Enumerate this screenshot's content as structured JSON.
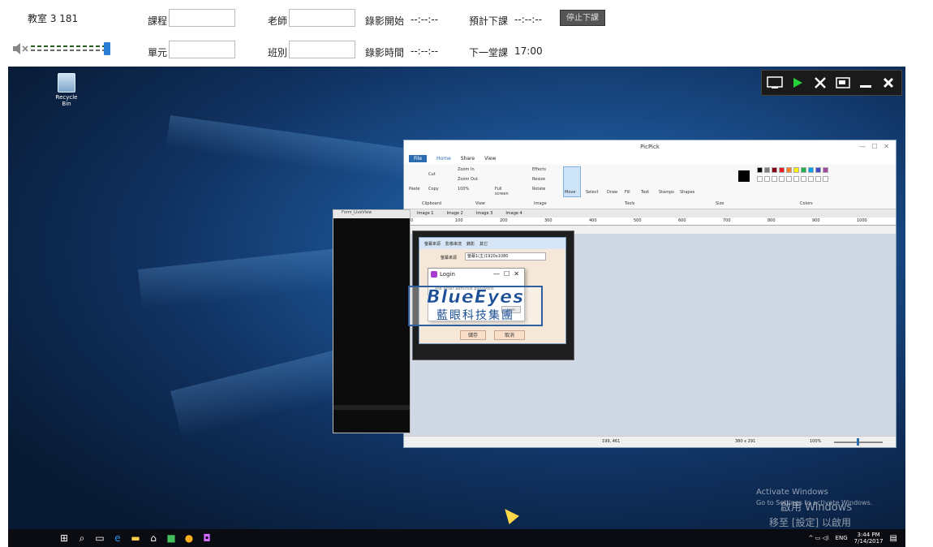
{
  "top": {
    "room": "教室 3 181",
    "course_label": "課程",
    "teacher_label": "老師",
    "record_start_label": "錄影開始",
    "record_start_value": "--:--:--",
    "planned_end_label": "預計下課",
    "planned_end_value": "--:--:--",
    "stop_button": "停止下課",
    "unit_label": "單元",
    "class_label": "班別",
    "record_time_label": "錄影時間",
    "record_time_value": "--:--:--",
    "next_class_label": "下一堂課",
    "next_class_value": "17:00"
  },
  "desktop": {
    "recycle_bin": "Recycle Bin",
    "liveview_title": "Form_LiveView",
    "activate_line1": "Activate Windows",
    "activate_line2": "Go to Settings to activate Windows.",
    "activate_line3": "啟用 Windows",
    "activate_line4": "移至 [設定] 以啟用 Windows。",
    "tray_lang": "ENG",
    "clock_time": "3:44 PM",
    "clock_date": "7/14/2017"
  },
  "picpick": {
    "title": "PicPick",
    "menu": [
      "File",
      "Home",
      "Share",
      "View"
    ],
    "ribbon": {
      "paste": "Paste",
      "cut": "Cut",
      "copy": "Copy",
      "zoom_in": "Zoom In",
      "zoom_out": "Zoom Out",
      "zoom_pct": "100%",
      "full_screen": "Full screen",
      "effects": "Effects",
      "resize": "Resize",
      "rotate": "Rotate",
      "move": "Move",
      "select": "Select",
      "draw": "Draw",
      "fill": "Fill",
      "text": "Text",
      "stamps": "Stamps",
      "shapes": "Shapes",
      "group_clipboard": "Clipboard",
      "group_view": "View",
      "group_image": "Image",
      "group_tools": "Tools",
      "group_size": "Size",
      "group_colors": "Colors"
    },
    "tabs": [
      "Image 1",
      "Image 2",
      "Image 3",
      "Image 4"
    ],
    "ruler_ticks": [
      "0",
      "100",
      "200",
      "300",
      "400",
      "500",
      "600",
      "700",
      "800",
      "900",
      "1000"
    ],
    "status_pos": "199, 461",
    "status_size": "380 x 291",
    "status_zoom": "100%"
  },
  "dialog": {
    "tabs": [
      "螢幕來源",
      "影像串流",
      "錄影",
      "其它"
    ],
    "source_label": "螢幕來源",
    "source_value": "螢幕1(主)1920x1080",
    "login_title": "Login",
    "login_prompt": "ase enter administ password:",
    "login_button": "Login",
    "save_button": "儲存",
    "cancel_button": "取消"
  },
  "logo": {
    "main": "BlueEyes",
    "sub": "藍眼科技集團"
  },
  "colors": [
    "#000000",
    "#7f7f7f",
    "#880015",
    "#ed1c24",
    "#ff7f27",
    "#fff200",
    "#22b14c",
    "#00a2e8",
    "#3f48cc",
    "#a349a4"
  ]
}
